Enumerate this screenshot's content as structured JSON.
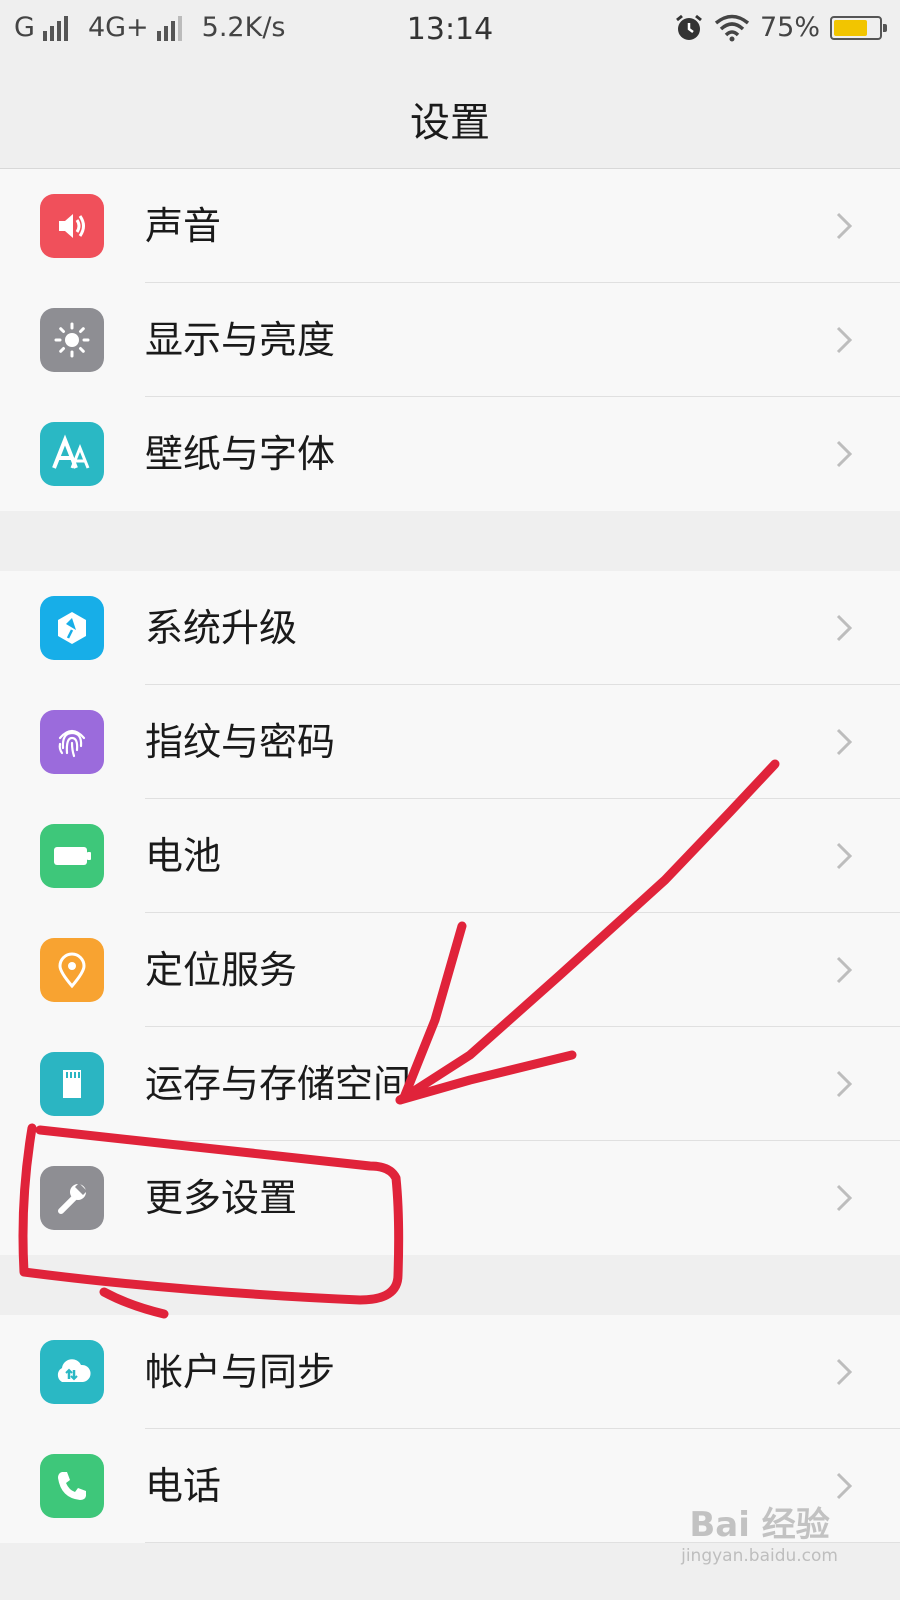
{
  "status": {
    "carrier1": "G",
    "carrier2": "4G+",
    "speed": "5.2K/s",
    "time": "13:14",
    "battery_pct": "75%",
    "battery_level": 0.75,
    "battery_color": "#f2c500"
  },
  "header": {
    "title": "设置"
  },
  "groups": [
    {
      "items": [
        {
          "label": "声音",
          "icon": "speaker-icon",
          "color": "#f0505b"
        },
        {
          "label": "显示与亮度",
          "icon": "brightness-icon",
          "color": "#8e8e93"
        },
        {
          "label": "壁纸与字体",
          "icon": "font-icon",
          "color": "#2ab8c4"
        }
      ]
    },
    {
      "items": [
        {
          "label": "系统升级",
          "icon": "system-update-icon",
          "color": "#17aee8"
        },
        {
          "label": "指纹与密码",
          "icon": "fingerprint-icon",
          "color": "#9b6bdc"
        },
        {
          "label": "电池",
          "icon": "battery-icon",
          "color": "#3ec77a"
        },
        {
          "label": "定位服务",
          "icon": "location-icon",
          "color": "#f8a331"
        },
        {
          "label": "运存与存储空间",
          "icon": "storage-icon",
          "color": "#2bb5c2"
        },
        {
          "label": "更多设置",
          "icon": "wrench-icon",
          "color": "#8e8e93"
        }
      ]
    },
    {
      "items": [
        {
          "label": "帐户与同步",
          "icon": "cloud-sync-icon",
          "color": "#2ab8c4"
        },
        {
          "label": "电话",
          "icon": "phone-icon",
          "color": "#3ec77a"
        }
      ]
    }
  ],
  "watermark": {
    "brand": "Bai 经验",
    "url": "jingyan.baidu.com"
  },
  "annotation_color": "#e0233a"
}
